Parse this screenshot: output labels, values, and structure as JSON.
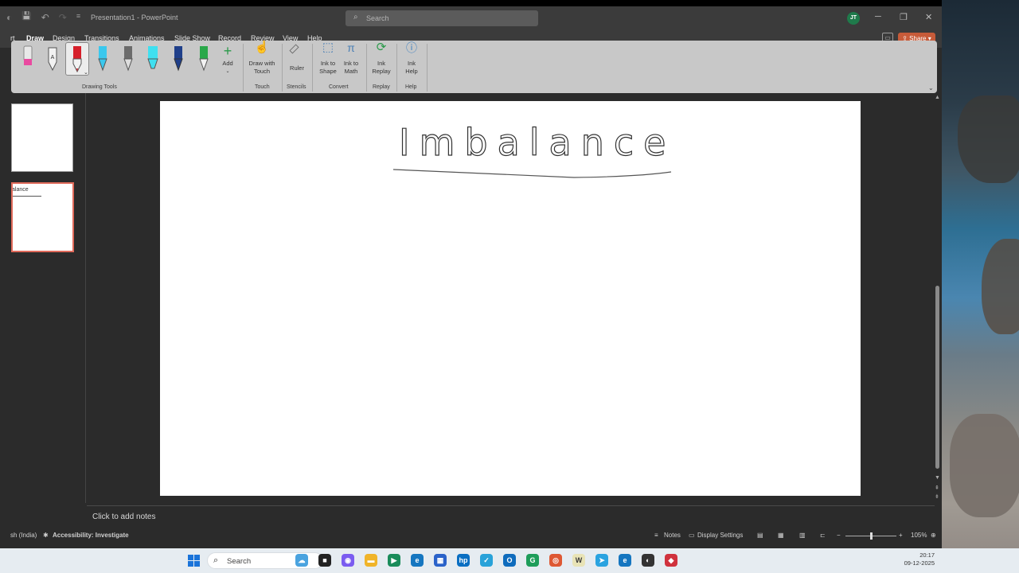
{
  "window": {
    "title": "Presentation1 - PowerPoint",
    "search_placeholder": "Search",
    "user_initials": "JT",
    "minimize": "─",
    "restore": "❐",
    "close": "✕"
  },
  "quick_access": {
    "save": "💾",
    "undo": "↶",
    "redo": "↷",
    "customize": "≡"
  },
  "tabs": [
    {
      "label": "rt"
    },
    {
      "label": "Draw",
      "active": true
    },
    {
      "label": "Design"
    },
    {
      "label": "Transitions"
    },
    {
      "label": "Animations"
    },
    {
      "label": "Slide Show"
    },
    {
      "label": "Record"
    },
    {
      "label": "Review"
    },
    {
      "label": "View"
    },
    {
      "label": "Help"
    }
  ],
  "share_label": "Share",
  "ribbon": {
    "add_label": "Add",
    "draw_with_touch": [
      "Draw with",
      "Touch"
    ],
    "ruler": "Ruler",
    "ink_to_shape": [
      "Ink to",
      "Shape"
    ],
    "ink_to_math": [
      "Ink to",
      "Math"
    ],
    "ink_replay": [
      "Ink",
      "Replay"
    ],
    "ink_help": [
      "Ink",
      "Help"
    ],
    "groups": {
      "drawing_tools": "Drawing Tools",
      "touch": "Touch",
      "stencils": "Stencils",
      "convert": "Convert",
      "replay": "Replay",
      "help": "Help"
    },
    "pen_colors": [
      "#e94aa0",
      "#5a5a5a",
      "#d61f2a",
      "#3ac8ee",
      "#6b6b6b",
      "#3fe0f0",
      "#1f3f8a",
      "#2aa84a"
    ]
  },
  "slides": {
    "thumb2_text": "alance"
  },
  "slide": {
    "handwriting": "Imbalance"
  },
  "notes": {
    "placeholder": "Click to add notes"
  },
  "status": {
    "language": "sh (India)",
    "accessibility": "Accessibility: Investigate",
    "notes": "Notes",
    "display_settings": "Display Settings",
    "zoom": "105%"
  },
  "taskbar": {
    "search_label": "Search",
    "time": "20:17",
    "date": "09-12-2025",
    "apps": [
      {
        "name": "widgets",
        "color": "#4aa3df",
        "glyph": "☁"
      },
      {
        "name": "task-view",
        "color": "#222222",
        "glyph": "■"
      },
      {
        "name": "copilot",
        "color": "#7b5cf0",
        "glyph": "◉"
      },
      {
        "name": "file-explorer",
        "color": "#f0b429",
        "glyph": "▬"
      },
      {
        "name": "meet",
        "color": "#1a8c5a",
        "glyph": "▶"
      },
      {
        "name": "edge",
        "color": "#1576c0",
        "glyph": "e"
      },
      {
        "name": "store",
        "color": "#2a62c9",
        "glyph": "▦"
      },
      {
        "name": "hp",
        "color": "#0a6fc2",
        "glyph": "hp"
      },
      {
        "name": "app-green",
        "color": "#28a2d9",
        "glyph": "✓"
      },
      {
        "name": "outlook",
        "color": "#0f6cbd",
        "glyph": "O"
      },
      {
        "name": "app-g",
        "color": "#1e9d5a",
        "glyph": "G"
      },
      {
        "name": "duckduckgo",
        "color": "#de5833",
        "glyph": "◎"
      },
      {
        "name": "word",
        "color": "#e8e3b6",
        "glyph": "W"
      },
      {
        "name": "telegram",
        "color": "#2aa3e0",
        "glyph": "➤"
      },
      {
        "name": "edge-2",
        "color": "#1576c0",
        "glyph": "e"
      },
      {
        "name": "app-dark",
        "color": "#333333",
        "glyph": "◐"
      },
      {
        "name": "app-red",
        "color": "#d0323d",
        "glyph": "◆"
      }
    ]
  }
}
